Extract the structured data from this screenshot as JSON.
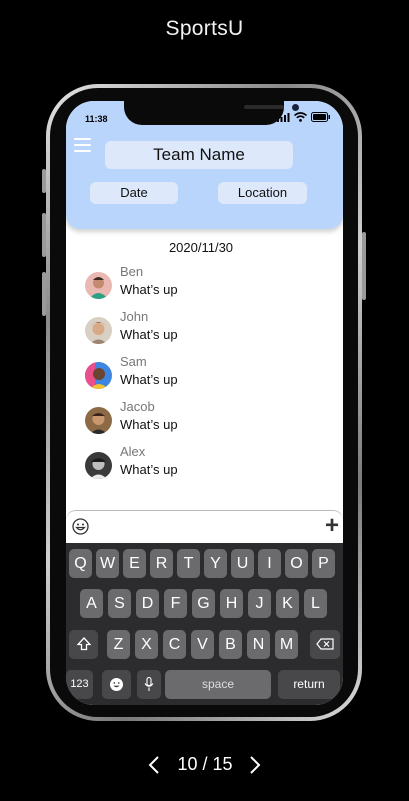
{
  "app_title": "SportsU",
  "status": {
    "time": "11:38"
  },
  "header": {
    "team_name": "Team Name",
    "date_button": "Date",
    "location_button": "Location"
  },
  "chat": {
    "date": "2020/11/30",
    "messages": [
      {
        "name": "Ben",
        "text": "What’s up",
        "avatar_color": "#5fb3a0"
      },
      {
        "name": "John",
        "text": "What’s up",
        "avatar_color": "#c49a78"
      },
      {
        "name": "Sam",
        "text": "What’s up",
        "avatar_color": "#3b7ad6"
      },
      {
        "name": "Jacob",
        "text": "What’s up",
        "avatar_color": "#6b4a36"
      },
      {
        "name": "Alex",
        "text": "What’s up",
        "avatar_color": "#4a4a4a"
      }
    ]
  },
  "input": {
    "plus_label": "+"
  },
  "keyboard": {
    "row1": [
      "Q",
      "W",
      "E",
      "R",
      "T",
      "Y",
      "U",
      "I",
      "O",
      "P"
    ],
    "row2": [
      "A",
      "S",
      "D",
      "F",
      "G",
      "H",
      "J",
      "K",
      "L"
    ],
    "row3": [
      "Z",
      "X",
      "C",
      "V",
      "B",
      "N",
      "M"
    ],
    "numbers_label": "123",
    "space_label": "space",
    "return_label": "return"
  },
  "pagination": {
    "current": "10",
    "separator": "/",
    "total": "15"
  }
}
